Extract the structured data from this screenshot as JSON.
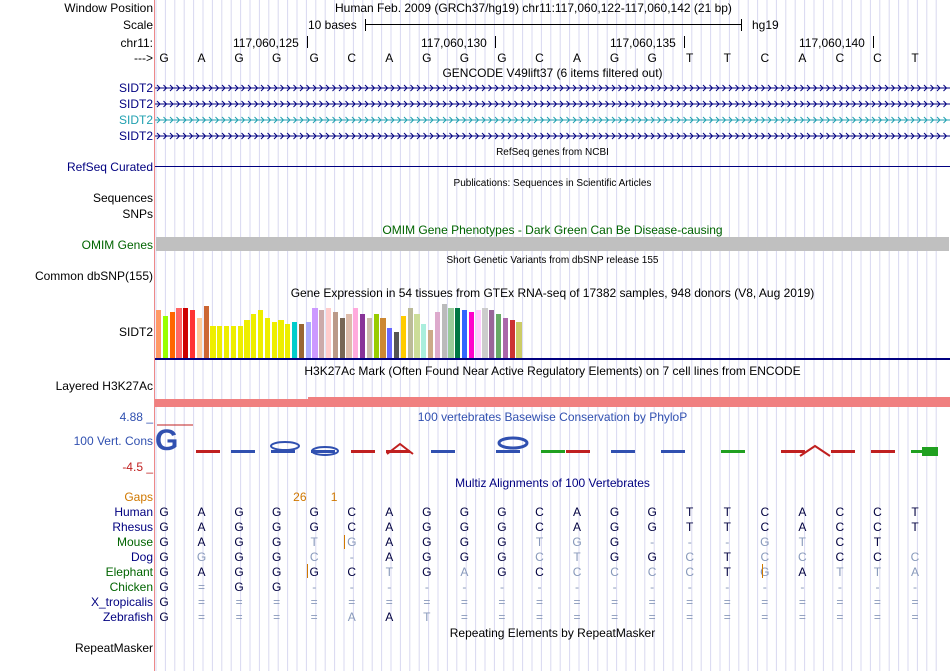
{
  "colors": {
    "navy": "#000080",
    "green": "#006400",
    "orange": "#d07800",
    "pink": "#f08080",
    "omim_gray": "#c0c0c0",
    "cons_blue": "#3050b0",
    "cons_red": "#c02020"
  },
  "header": {
    "window_position_label": "Window Position",
    "window_position_text": "Human Feb. 2009 (GRCh37/hg19)   chr11:117,060,122-117,060,142 (21 bp)",
    "scale_label": "Scale",
    "scale_text": "10 bases",
    "scale_assembly": "hg19",
    "chrom_label": "chr11:",
    "coord_ticks": [
      "117,060,125",
      "117,060,130",
      "117,060,135",
      "117,060,140"
    ],
    "strand_label": "--->",
    "sequence": [
      "G",
      "A",
      "G",
      "G",
      "G",
      "C",
      "A",
      "G",
      "G",
      "G",
      "C",
      "A",
      "G",
      "G",
      "T",
      "T",
      "C",
      "A",
      "C",
      "C",
      "T"
    ]
  },
  "tracks": {
    "gencode_title": "GENCODE V49lift37 (6 items filtered out)",
    "gencode_items": [
      "SIDT2",
      "SIDT2",
      "SIDT2",
      "SIDT2"
    ],
    "refseq_label": "RefSeq Curated",
    "refseq_title": "RefSeq genes from NCBI",
    "publications_title": "Publications: Sequences in Scientific Articles",
    "sequences_label": "Sequences",
    "snps_label": "SNPs",
    "omim_title": "OMIM Gene Phenotypes - Dark Green Can Be Disease-causing",
    "omim_label": "OMIM Genes",
    "dbsnp_title": "Short Genetic Variants from dbSNP release 155",
    "dbsnp_label": "Common dbSNP(155)",
    "gtex_title": "Gene Expression in 54 tissues from GTEx RNA-seq of 17382 samples, 948 donors (V8, Aug 2019)",
    "gtex_label": "SIDT2",
    "h3k27ac_title": "H3K27Ac Mark (Often Found Near Active Regulatory Elements) on 7 cell lines from ENCODE",
    "h3k27ac_label": "Layered H3K27Ac",
    "cons_title": "100 vertebrates Basewise Conservation by PhyloP",
    "cons_label": "100 Vert. Cons",
    "cons_max": "4.88 _",
    "cons_min": "-4.5 _",
    "multiz_title": "Multiz Alignments of 100 Vertebrates",
    "repeat_title": "Repeating Elements by RepeatMasker",
    "repeat_label": "RepeatMasker"
  },
  "gtex_heights": [
    48,
    42,
    46,
    50,
    50,
    48,
    40,
    52,
    32,
    32,
    32,
    32,
    32,
    38,
    44,
    48,
    40,
    36,
    38,
    34,
    36,
    34,
    36,
    50,
    48,
    50,
    46,
    40,
    44,
    50,
    44,
    40,
    44,
    40,
    30,
    26,
    42,
    50,
    44,
    34,
    28,
    46,
    54,
    50,
    50,
    48,
    46,
    48,
    50,
    48,
    44,
    40,
    38,
    36
  ],
  "gtex_colors": [
    "#ff9966",
    "#99ff00",
    "#ff6600",
    "#ff6666",
    "#cc0000",
    "#ff3333",
    "#ffcc99",
    "#cc6633",
    "#eeee00",
    "#eeee00",
    "#eeee00",
    "#eeee00",
    "#eeee00",
    "#eeee00",
    "#eeee00",
    "#eeee00",
    "#eeee00",
    "#eeee00",
    "#eeee00",
    "#eeee00",
    "#00cccc",
    "#996633",
    "#aaaaff",
    "#cc99ff",
    "#ccaaaa",
    "#ffcccc",
    "#bb9988",
    "#776655",
    "#ddbbaa",
    "#ffaadd",
    "#883399",
    "#ccbbaa",
    "#99cc00",
    "#cc8833",
    "#6666ff",
    "#555555",
    "#ffcc00",
    "#bbbb99",
    "#ccdd99",
    "#aaeedd",
    "#ccaa88",
    "#ddaacc",
    "#bbbbbb",
    "#99cc99",
    "#007744",
    "#3366ff",
    "#ff00cc",
    "#ffccff",
    "#cccccc",
    "#996699",
    "#66aa66",
    "#aa66aa",
    "#cc3333",
    "#cccc66"
  ],
  "multiz_gaps_label": "Gaps",
  "multiz_gaps": [
    {
      "col": 3.6,
      "text": "26"
    },
    {
      "col": 4.6,
      "text": "1"
    }
  ],
  "species": [
    {
      "name": "Human",
      "color": "#000080",
      "bases": [
        "G",
        "A",
        "G",
        "G",
        "G",
        "C",
        "A",
        "G",
        "G",
        "G",
        "C",
        "A",
        "G",
        "G",
        "T",
        "T",
        "C",
        "A",
        "C",
        "C",
        "T"
      ],
      "faded": []
    },
    {
      "name": "Rhesus",
      "color": "#000080",
      "bases": [
        "G",
        "A",
        "G",
        "G",
        "G",
        "C",
        "A",
        "G",
        "G",
        "G",
        "C",
        "A",
        "G",
        "G",
        "T",
        "T",
        "C",
        "A",
        "C",
        "C",
        "T"
      ],
      "faded": []
    },
    {
      "name": "Mouse",
      "color": "#006400",
      "bases": [
        "G",
        "A",
        "G",
        "G",
        "T",
        "G",
        "A",
        "G",
        "G",
        "G",
        "T",
        "G",
        "G",
        "-",
        "-",
        "-",
        "G",
        "T",
        "C",
        "T"
      ],
      "faded": [
        4,
        5,
        10,
        11,
        13,
        14,
        15,
        16,
        17
      ]
    },
    {
      "name": "Dog",
      "color": "#000080",
      "bases": [
        "G",
        "G",
        "G",
        "G",
        "C",
        "-",
        "A",
        "G",
        "G",
        "G",
        "C",
        "T",
        "G",
        "G",
        "C",
        "T",
        "C",
        "C",
        "C",
        "C",
        "C"
      ],
      "faded": [
        1,
        4,
        5,
        10,
        11,
        14,
        16,
        17,
        20
      ]
    },
    {
      "name": "Elephant",
      "color": "#006400",
      "bases": [
        "G",
        "A",
        "G",
        "G",
        "G",
        "C",
        "T",
        "G",
        "A",
        "G",
        "C",
        "C",
        "C",
        "C",
        "C",
        "T",
        "G",
        "A",
        "T",
        "T",
        "A"
      ],
      "faded": [
        6,
        8,
        11,
        12,
        13,
        14,
        16,
        18,
        19,
        20
      ]
    },
    {
      "name": "Chicken",
      "color": "#006400",
      "bases": [
        "G",
        "=",
        "G",
        "G",
        "-",
        "-",
        "-",
        "-",
        "-",
        "-",
        "-",
        "-",
        "-",
        "-",
        "-",
        "-",
        "-",
        "-",
        "-",
        "-",
        "-"
      ],
      "faded": [
        1,
        4,
        5,
        6,
        7,
        8,
        9,
        10,
        11,
        12,
        13,
        14,
        15,
        16,
        17,
        18,
        19,
        20
      ]
    },
    {
      "name": "X_tropicalis",
      "color": "#000080",
      "bases": [
        "G",
        "=",
        "=",
        "=",
        "=",
        "=",
        "=",
        "=",
        "=",
        "=",
        "=",
        "=",
        "=",
        "=",
        "=",
        "=",
        "=",
        "=",
        "=",
        "=",
        "="
      ],
      "faded": [
        1,
        2,
        3,
        4,
        5,
        6,
        7,
        8,
        9,
        10,
        11,
        12,
        13,
        14,
        15,
        16,
        17,
        18,
        19,
        20
      ]
    },
    {
      "name": "Zebrafish",
      "color": "#000080",
      "bases": [
        "G",
        "=",
        "=",
        "=",
        "=",
        "A",
        "A",
        "T",
        "=",
        "=",
        "=",
        "=",
        "=",
        "=",
        "=",
        "=",
        "=",
        "=",
        "=",
        "=",
        "="
      ],
      "faded": [
        1,
        2,
        3,
        4,
        5,
        7,
        8,
        9,
        10,
        11,
        12,
        13,
        14,
        15,
        16,
        17,
        18,
        19,
        20
      ]
    }
  ]
}
